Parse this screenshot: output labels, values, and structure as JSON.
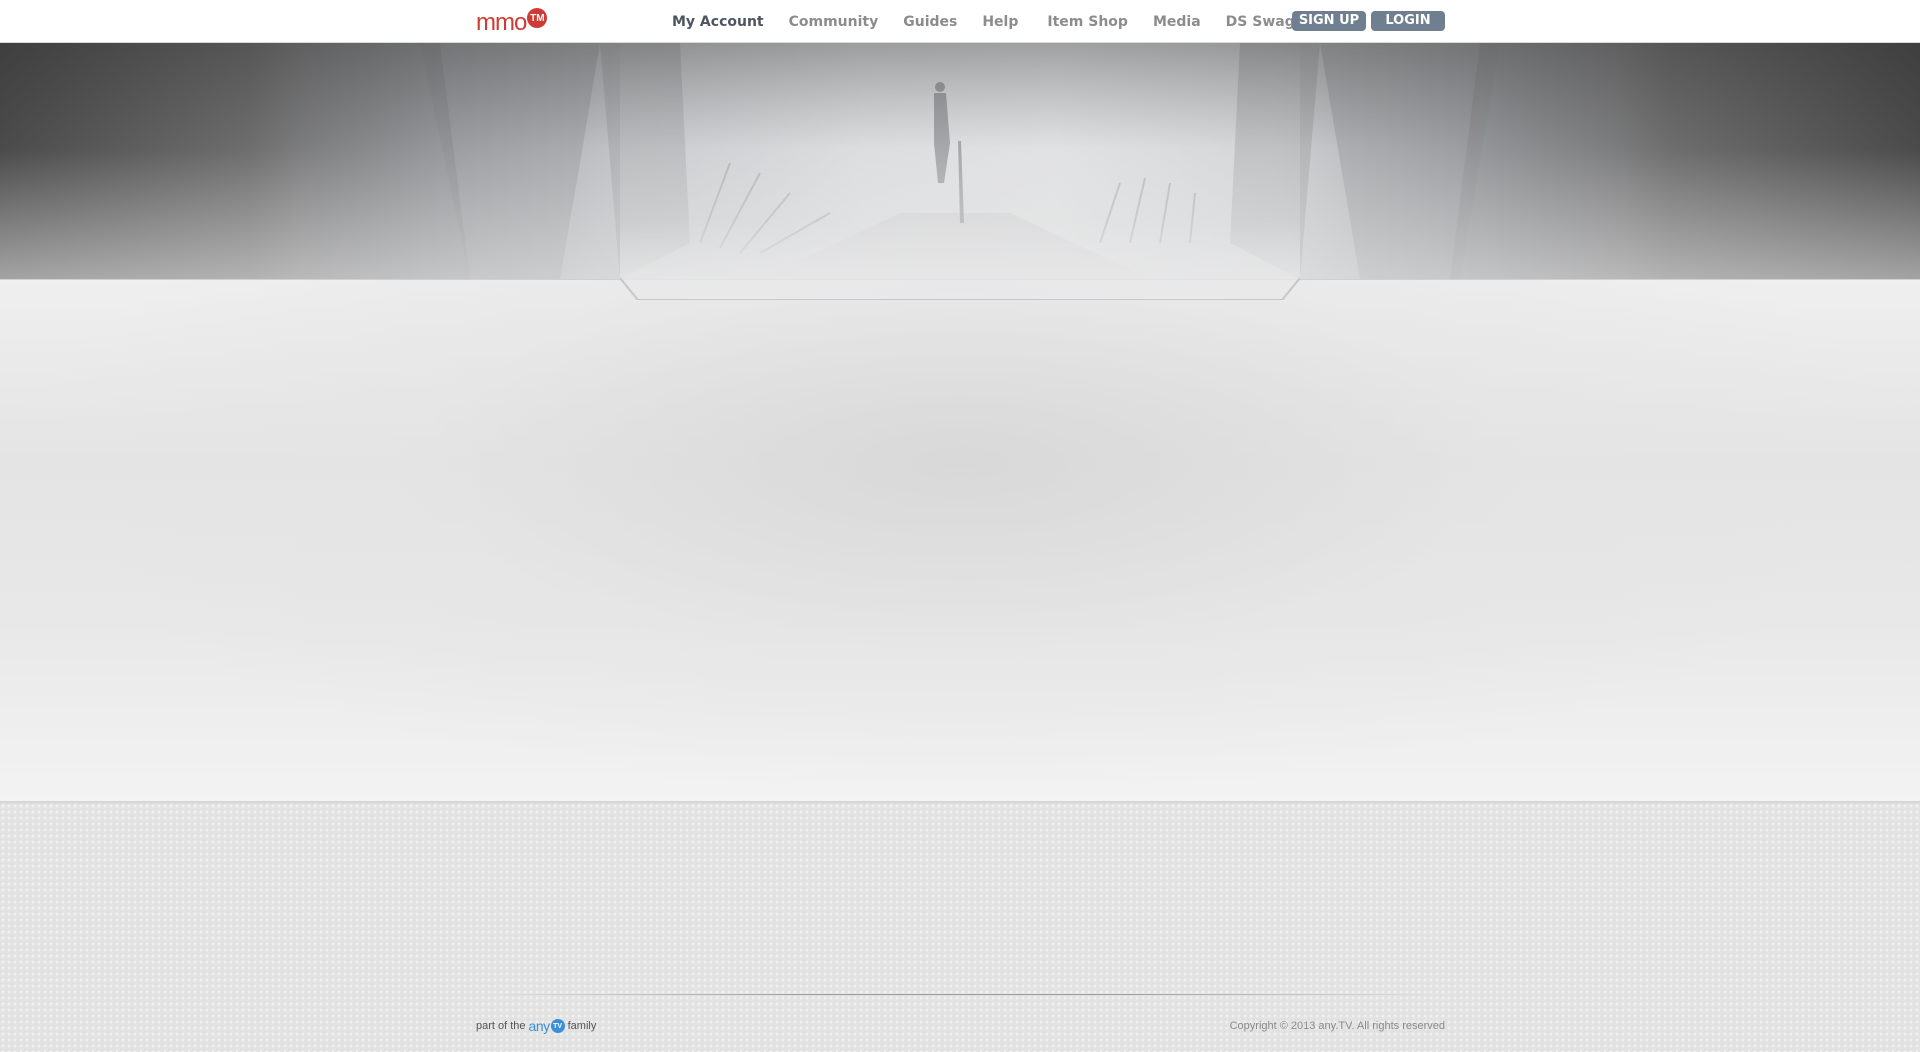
{
  "header": {
    "logo_text": "mmo",
    "logo_badge": "TM",
    "nav": [
      {
        "label": "My Account",
        "active": true
      },
      {
        "label": "Community"
      },
      {
        "label": "Guides"
      },
      {
        "label": "Help"
      },
      {
        "label": "Item Shop"
      },
      {
        "label": "Media"
      },
      {
        "label": "DS Swag"
      }
    ],
    "signup_label": "SIGN UP",
    "login_label": "LOGIN"
  },
  "footer": {
    "prefix": "part of the",
    "brand_text": "any",
    "brand_badge": "TV",
    "suffix": "family",
    "copyright": "Copyright © 2013 any.TV. All rights reserved"
  },
  "colors": {
    "logo": "#cf3b34",
    "nav_active": "#4d5560",
    "nav_inactive": "#8c8c8c",
    "auth_button": "#6f7f8f",
    "anytv_blue": "#3a8fd6"
  }
}
